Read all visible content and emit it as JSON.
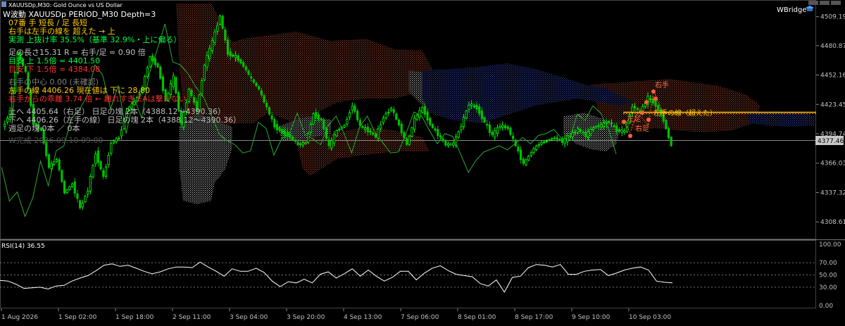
{
  "window": {
    "title": "XAUUSDp,M30:  Gold Ounce vs US Dollar",
    "brand": "WBridge"
  },
  "overlay": {
    "line1": "W波動  XAUUSDp PERIOD_M30  Depth=3",
    "line2": "07番 手 短長 / 足 長短",
    "line3": "右手は左手の線を 超えた → 上",
    "line4": "実測 上抜け率 35.5%（基準 32.9%・上に偏る）",
    "line5": "足の長さ15.31  R = 右手/足 = 0.90 倍",
    "line6": "目安 上 1.5倍 = 4401.50",
    "line7": "目安 下 1.5倍 = 4384.08",
    "line8": "右手の中心 0.00 (未確認)",
    "line9": "左手の線 4406.26  現在値は 下に 28.80",
    "line10": "右手からの乖離 3.74 倍 ← 離れすぎ EAは撃たない",
    "line11": "上へ 4405.64（右足）  日足の塊 2本（4388.12〜4390.36）",
    "line12": "下へ 4406.26（左手の線）  日足の塊 2本（4388.12〜4390.36）",
    "line13": "週足の塊  0本 ／ 0本",
    "line14": "W完成 2026.09.10 09:00"
  },
  "annotations": {
    "right_hand": "右手",
    "left_hand_line": "左手の線（超えた）",
    "right_foot": "右足",
    "left_foot": "左足"
  },
  "price_axis": {
    "ticks": [
      "4509.19",
      "4480.87",
      "4452.16",
      "4423.45",
      "4394.74",
      "4366.03",
      "4337.32",
      "4308.61"
    ],
    "current_price": "4377.46",
    "current_value": 4377.46,
    "left_hand_line_value": 4406.26,
    "range": [
      4295,
      4522
    ]
  },
  "rsi": {
    "label": "RSI(14) 36.55",
    "ticks": [
      "100.00",
      "70.00",
      "50.00",
      "30.00",
      "0.00"
    ],
    "levels": [
      70,
      50,
      30
    ]
  },
  "time_axis": {
    "labels": [
      "1 Aug 2026",
      "1 Sep 02:00",
      "1 Sep 18:00",
      "2 Sep 11:00",
      "3 Sep 04:00",
      "3 Sep 20:00",
      "4 Sep 13:00",
      "7 Sep 06:00",
      "8 Sep 01:00",
      "8 Sep 17:00",
      "9 Sep 10:00",
      "10 Sep 03:00"
    ]
  },
  "colors": {
    "bull": "#00ff00",
    "bear": "#00c000",
    "cloud_red": "#a0402a",
    "cloud_gray": "#c8c8c8",
    "cloud_blue": "#3040b0",
    "line_green": "#2ea82e",
    "gold": "#ffcc00",
    "red_text": "#ff3030",
    "green_text": "#00ff40",
    "orange": "#ff7040"
  },
  "chart_data": {
    "type": "line",
    "series": [
      {
        "values": [
          4400,
          4416,
          4474,
          4455,
          4405,
          4398,
          4362,
          4370,
          4337,
          4346,
          4322,
          4340,
          4376,
          4352,
          4386,
          4391,
          4418,
          4426,
          4440,
          4470,
          4460,
          4427,
          4450,
          4403,
          4438,
          4418,
          4462,
          4485,
          4510,
          4473,
          4470,
          4461,
          4448,
          4438,
          4420,
          4402,
          4396,
          4392,
          4384,
          4386,
          4414,
          4408,
          4382,
          4398,
          4403,
          4423,
          4402,
          4398,
          4392,
          4411,
          4420,
          4403,
          4384,
          4409,
          4420,
          4404,
          4394,
          4384,
          4385,
          4403,
          4424,
          4420,
          4406,
          4393,
          4403,
          4400,
          4383,
          4365,
          4377,
          4385,
          4388,
          4391,
          4387,
          4393,
          4399,
          4393,
          4401,
          4403,
          4407,
          4398,
          4397,
          4422,
          4416,
          4430,
          4423,
          4408,
          4383
        ]
      },
      {
        "values": [
          41,
          40,
          35,
          28,
          29,
          30,
          27,
          32,
          33,
          40,
          45,
          49,
          57,
          66,
          68,
          64,
          66,
          61,
          56,
          52,
          55,
          60,
          63,
          63,
          62,
          71,
          63,
          56,
          48,
          60,
          56,
          56,
          61,
          54,
          40,
          31,
          39,
          37,
          43,
          37,
          51,
          55,
          45,
          52,
          60,
          48,
          58,
          48,
          40,
          46,
          56,
          56,
          42,
          53,
          61,
          65,
          57,
          51,
          49,
          47,
          36,
          32,
          42,
          22,
          46,
          48,
          62,
          67,
          66,
          63,
          67,
          51,
          51,
          56,
          58,
          59,
          49,
          53,
          58,
          61,
          63,
          58,
          40,
          38,
          37
        ]
      }
    ]
  }
}
